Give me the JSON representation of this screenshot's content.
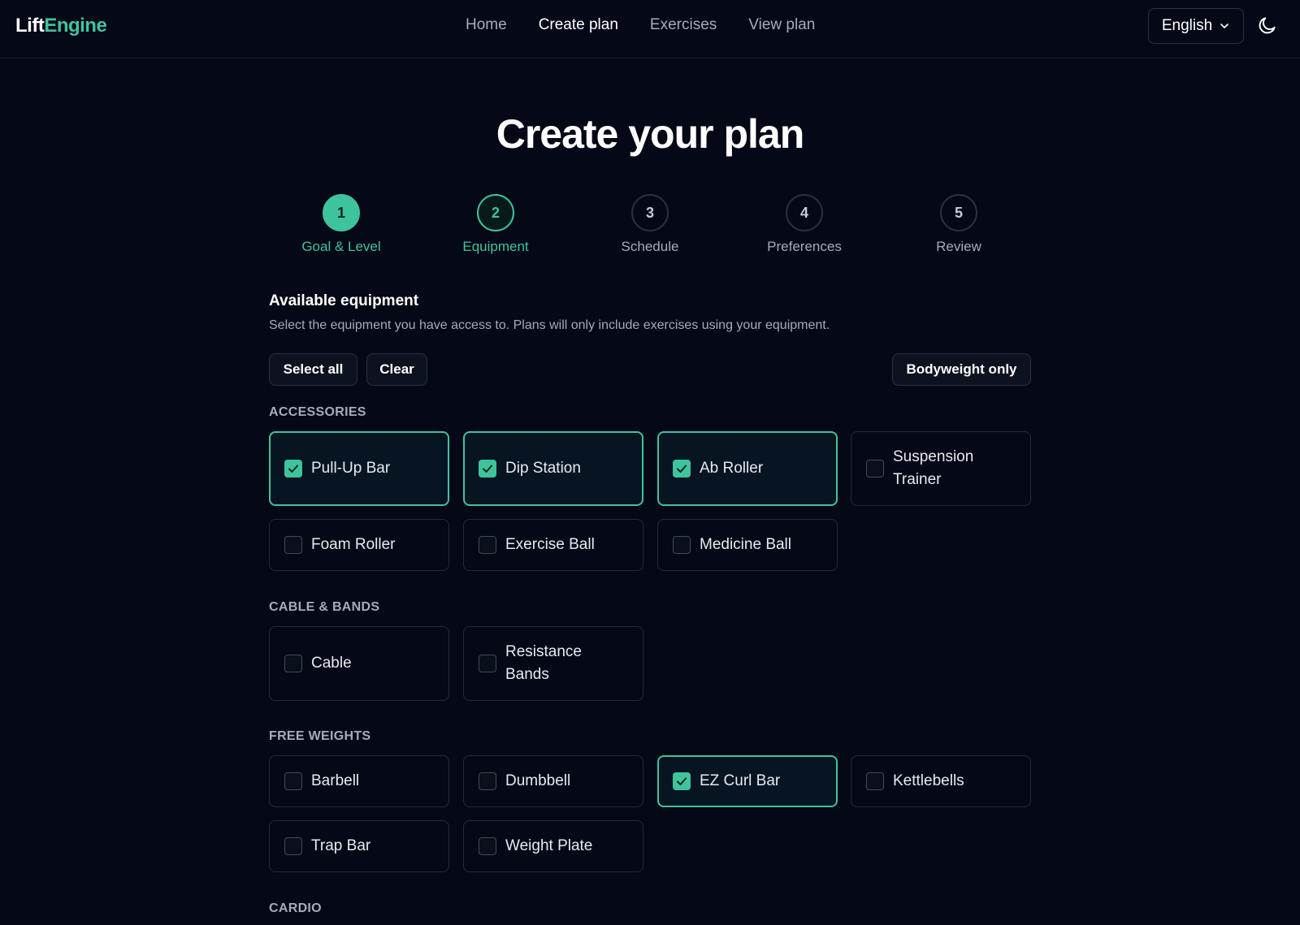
{
  "header": {
    "logo_part1": "Lift",
    "logo_part2": "Engine",
    "nav": [
      {
        "label": "Home",
        "active": false
      },
      {
        "label": "Create plan",
        "active": true
      },
      {
        "label": "Exercises",
        "active": false
      },
      {
        "label": "View plan",
        "active": false
      }
    ],
    "language": "English",
    "theme_icon": "moon-icon"
  },
  "page_title": "Create your plan",
  "steps": [
    {
      "number": "1",
      "label": "Goal & Level",
      "state": "done"
    },
    {
      "number": "2",
      "label": "Equipment",
      "state": "current"
    },
    {
      "number": "3",
      "label": "Schedule",
      "state": "upcoming"
    },
    {
      "number": "4",
      "label": "Preferences",
      "state": "upcoming"
    },
    {
      "number": "5",
      "label": "Review",
      "state": "upcoming"
    }
  ],
  "equipment": {
    "heading": "Available equipment",
    "subheading": "Select the equipment you have access to. Plans will only include exercises using your equipment.",
    "select_all": "Select all",
    "clear": "Clear",
    "bodyweight_only": "Bodyweight only"
  },
  "categories": [
    {
      "name": "ACCESSORIES",
      "items": [
        {
          "label": "Pull-Up Bar",
          "checked": true
        },
        {
          "label": "Dip Station",
          "checked": true
        },
        {
          "label": "Ab Roller",
          "checked": true
        },
        {
          "label": "Suspension Trainer",
          "checked": false
        },
        {
          "label": "Foam Roller",
          "checked": false
        },
        {
          "label": "Exercise Ball",
          "checked": false
        },
        {
          "label": "Medicine Ball",
          "checked": false
        }
      ]
    },
    {
      "name": "CABLE & BANDS",
      "items": [
        {
          "label": "Cable",
          "checked": false
        },
        {
          "label": "Resistance Bands",
          "checked": false
        }
      ]
    },
    {
      "name": "FREE WEIGHTS",
      "items": [
        {
          "label": "Barbell",
          "checked": false
        },
        {
          "label": "Dumbbell",
          "checked": false
        },
        {
          "label": "EZ Curl Bar",
          "checked": true
        },
        {
          "label": "Kettlebells",
          "checked": false
        },
        {
          "label": "Trap Bar",
          "checked": false
        },
        {
          "label": "Weight Plate",
          "checked": false
        }
      ]
    },
    {
      "name": "CARDIO",
      "items": []
    }
  ],
  "colors": {
    "accent": "#3ec49d",
    "background": "#050816",
    "border": "#252b3a"
  }
}
